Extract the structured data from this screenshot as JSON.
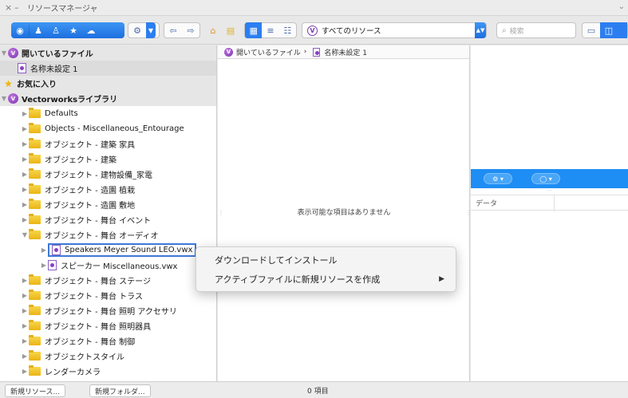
{
  "window": {
    "title": "リソースマネージャ"
  },
  "toolbar": {
    "filter_value": "すべてのリソース",
    "search_placeholder": "検索"
  },
  "sidebar": {
    "open_files_label": "開いているファイル",
    "open_file_name": "名称未設定 1",
    "favorites_label": "お気に入り",
    "library_label": "Vectorworksライブラリ",
    "items": [
      {
        "label": "Defaults"
      },
      {
        "label": "Objects - Miscellaneous_Entourage"
      },
      {
        "label": "オブジェクト - 建築 家具"
      },
      {
        "label": "オブジェクト - 建築"
      },
      {
        "label": "オブジェクト - 建物設備_家電"
      },
      {
        "label": "オブジェクト - 造園 植栽"
      },
      {
        "label": "オブジェクト - 造園 敷地"
      },
      {
        "label": "オブジェクト - 舞台 イベント"
      },
      {
        "label": "オブジェクト - 舞台 オーディオ"
      },
      {
        "label": "Speakers Meyer Sound LEO.vwx"
      },
      {
        "label": "スピーカー Miscellaneous.vwx"
      },
      {
        "label": "オブジェクト - 舞台 ステージ"
      },
      {
        "label": "オブジェクト - 舞台 トラス"
      },
      {
        "label": "オブジェクト - 舞台 照明 アクセサリ"
      },
      {
        "label": "オブジェクト - 舞台 照明器具"
      },
      {
        "label": "オブジェクト - 舞台 制御"
      },
      {
        "label": "オブジェクトスタイル"
      },
      {
        "label": "レンダーカメラ"
      }
    ]
  },
  "middle": {
    "crumb_root": "開いているファイル",
    "crumb_sep": "›",
    "crumb_file": "名称未設定 1",
    "empty_message": "表示可能な項目はありません"
  },
  "right": {
    "data_header": "データ"
  },
  "bottom": {
    "new_resource": "新規リソース...",
    "new_folder": "新規フォルダ...",
    "item_count": "0 項目"
  },
  "context_menu": {
    "items": [
      {
        "label": "ダウンロードしてインストール"
      },
      {
        "label": "アクティブファイルに新規リソースを作成"
      }
    ]
  },
  "colors": {
    "accent": "#1e8df4",
    "selection_border": "#3f78d8",
    "vw_purple": "#7a2fb0"
  }
}
